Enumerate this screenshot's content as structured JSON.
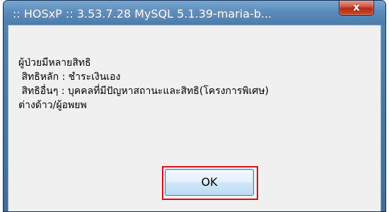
{
  "window": {
    "title": ":: HOSxP :: 3.53.7.28 MySQL 5.1.39-maria-b..."
  },
  "title_bar": {
    "close_icon": "close-icon",
    "close_glyph": "x"
  },
  "dialog": {
    "message_lines": [
      "ผู้ป่วยมีหลายสิทธิ",
      " สิทธิหลัก : ชำระเงินเอง",
      " สิทธิอื่นๆ : บุคคลที่มีปัญหาสถานะและสิทธิ(โครงการพิเศษ)",
      "ต่างด้าว/ผู้อพยพ"
    ],
    "ok_label": "OK"
  },
  "colors": {
    "title_bar": "#4e7eab",
    "close_button": "#c94a2e",
    "client_background": "#f0f0f0",
    "highlight_box": "#d0101c",
    "ok_button_border": "#3c7fb1"
  }
}
